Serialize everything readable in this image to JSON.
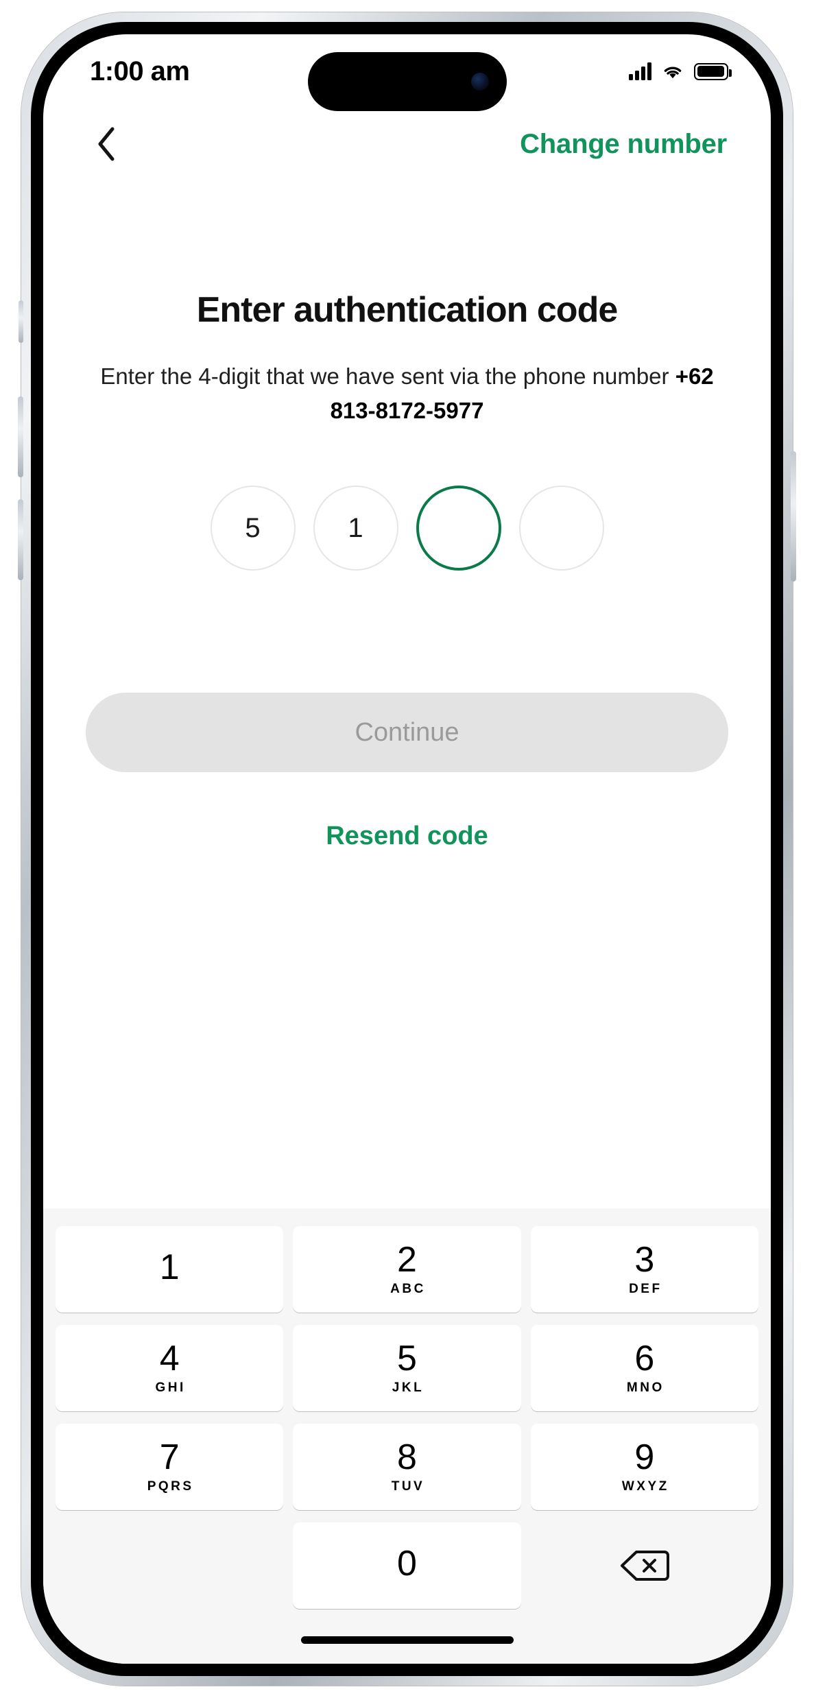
{
  "theme": {
    "brand_green": "#11935c",
    "active_ring": "#0b7a4b",
    "disabled_bg": "#e3e3e3",
    "disabled_text": "#9a9a9a",
    "keypad_bg": "#f6f6f7"
  },
  "status_bar": {
    "time": "1:00 am",
    "icons": [
      "cellular-signal-icon",
      "wifi-icon",
      "battery-icon"
    ],
    "battery_level_percent": 85
  },
  "header": {
    "back_icon": "chevron-left-icon",
    "title": "Change number"
  },
  "main": {
    "heading": "Enter authentication code",
    "subtitle_prefix": "Enter the 4-digit that we have sent via the phone number ",
    "phone_number": "+62 813-8172-5977",
    "otp": {
      "length": 4,
      "active_index": 2,
      "digits": [
        "5",
        "1",
        "",
        ""
      ]
    },
    "continue_label": "Continue",
    "continue_enabled": false,
    "resend_label": "Resend code"
  },
  "keypad": {
    "keys": [
      {
        "num": "1",
        "sub": ""
      },
      {
        "num": "2",
        "sub": "ABC"
      },
      {
        "num": "3",
        "sub": "DEF"
      },
      {
        "num": "4",
        "sub": "GHI"
      },
      {
        "num": "5",
        "sub": "JKL"
      },
      {
        "num": "6",
        "sub": "MNO"
      },
      {
        "num": "7",
        "sub": "PQRS"
      },
      {
        "num": "8",
        "sub": "TUV"
      },
      {
        "num": "9",
        "sub": "WXYZ"
      },
      {
        "num": "0",
        "sub": ""
      }
    ],
    "delete_icon": "backspace-icon"
  }
}
